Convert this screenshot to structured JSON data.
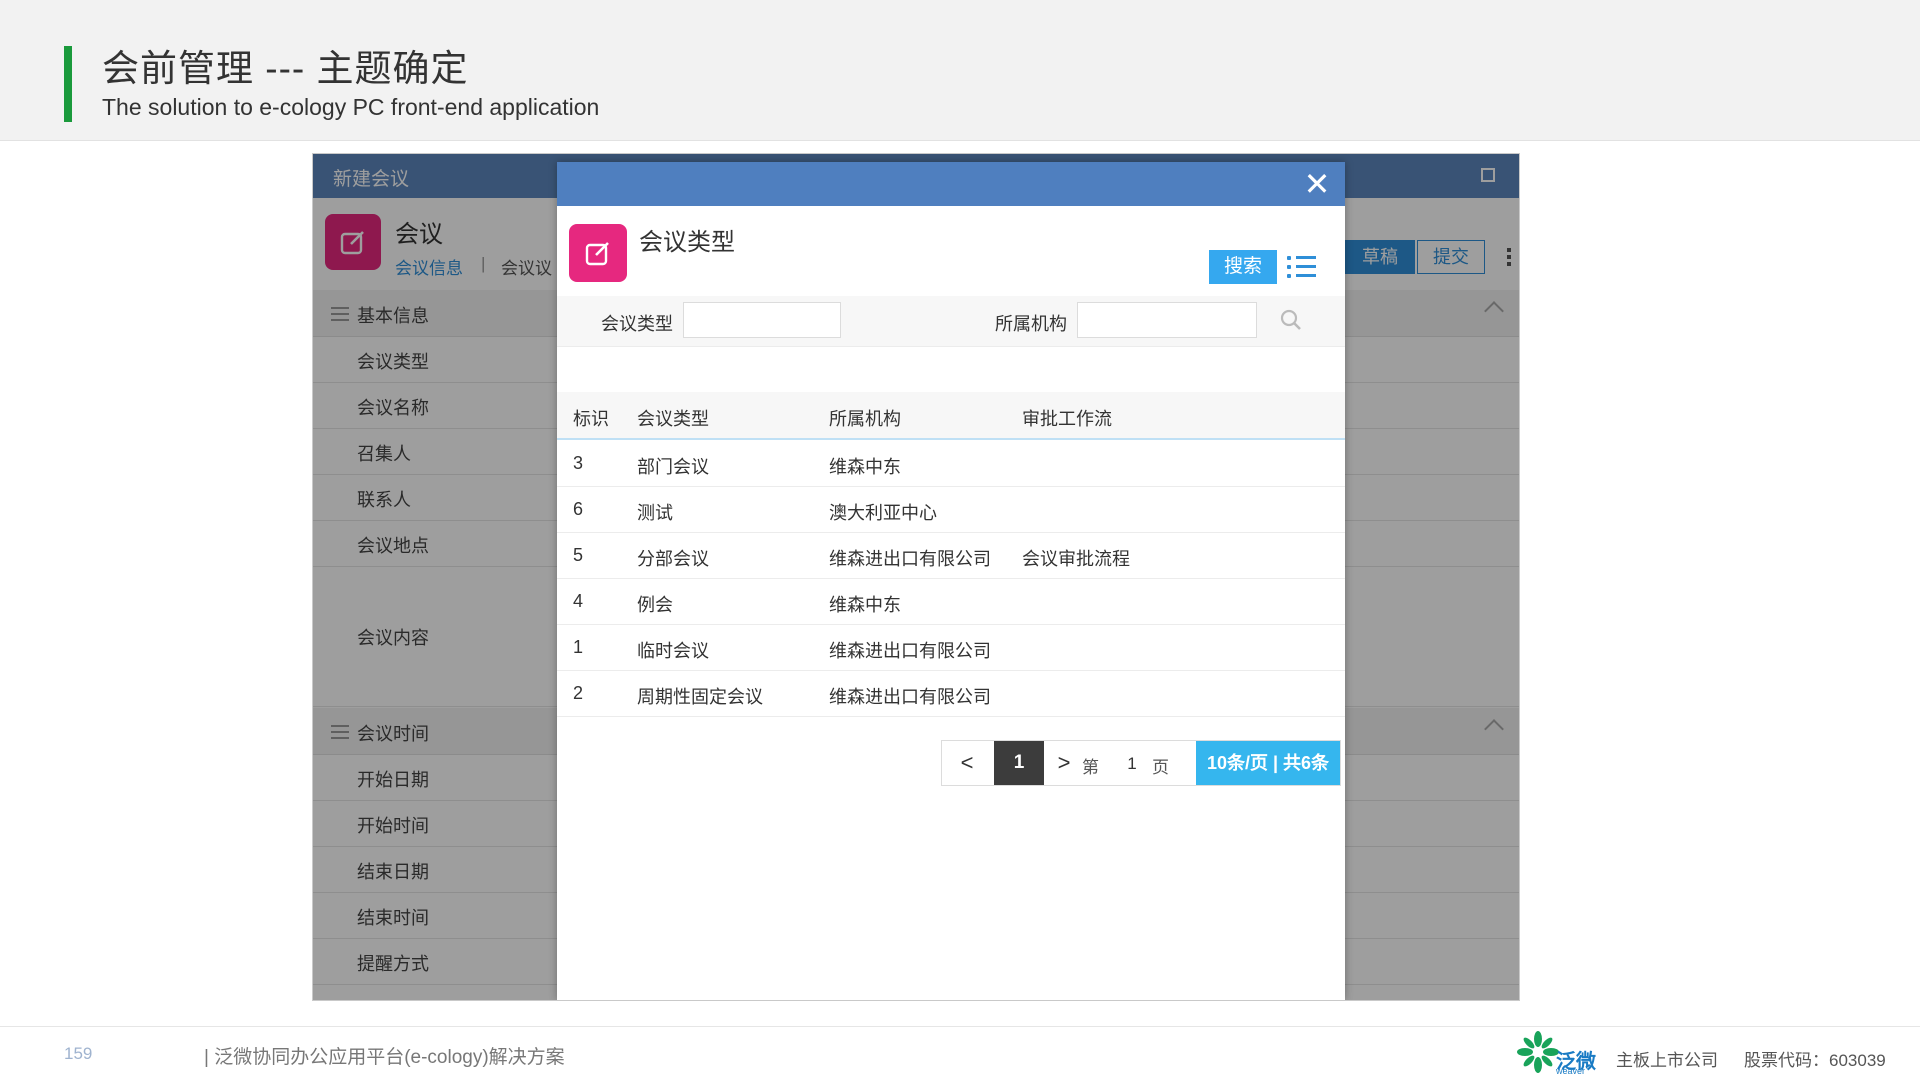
{
  "slide": {
    "title": "会前管理 --- 主题确定",
    "subtitle": "The solution to e-cology PC front-end application",
    "page_number": "159",
    "footer_text": "| 泛微协同办公应用平台(e-cology)解决方案",
    "logo_text": "泛微",
    "logo_sub": "weaver",
    "listing": "主板上市公司",
    "stock_code": "股票代码：603039",
    "accent_color": "#1a9a3c"
  },
  "background_form": {
    "window_title": "新建会议",
    "form_title": "会议",
    "tab_active": "会议信息",
    "tab_sep": "|",
    "tab_2": "会议议",
    "draft_label": "草稿",
    "submit_label": "提交",
    "group_basic": "基本信息",
    "fields_basic": [
      "会议类型",
      "会议名称",
      "召集人",
      "联系人",
      "会议地点",
      "会议内容"
    ],
    "group_time": "会议时间",
    "fields_time": [
      "开始日期",
      "开始时间",
      "结束日期",
      "结束时间",
      "提醒方式"
    ]
  },
  "dialog": {
    "title": "会议类型",
    "search_label": "搜索",
    "filter": {
      "type_label": "会议类型",
      "type_value": "",
      "org_label": "所属机构",
      "org_value": ""
    },
    "columns": [
      "标识",
      "会议类型",
      "所属机构",
      "审批工作流"
    ],
    "rows": [
      [
        "3",
        "部门会议",
        "维森中东",
        ""
      ],
      [
        "6",
        "测试",
        "澳大利亚中心",
        ""
      ],
      [
        "5",
        "分部会议",
        "维森进出口有限公司",
        "会议审批流程"
      ],
      [
        "4",
        "例会",
        "维森中东",
        ""
      ],
      [
        "1",
        "临时会议",
        "维森进出口有限公司",
        ""
      ],
      [
        "2",
        "周期性固定会议",
        "维森进出口有限公司",
        ""
      ]
    ],
    "pager": {
      "prev": "<",
      "current": "1",
      "next": ">",
      "di": "第",
      "page_input": "1",
      "ye": "页",
      "size_info": "10条/页 | 共6条"
    },
    "accent_color": "#35a8ef",
    "titlebar_color": "#4f7fbf",
    "icon_color": "#e6287f"
  }
}
